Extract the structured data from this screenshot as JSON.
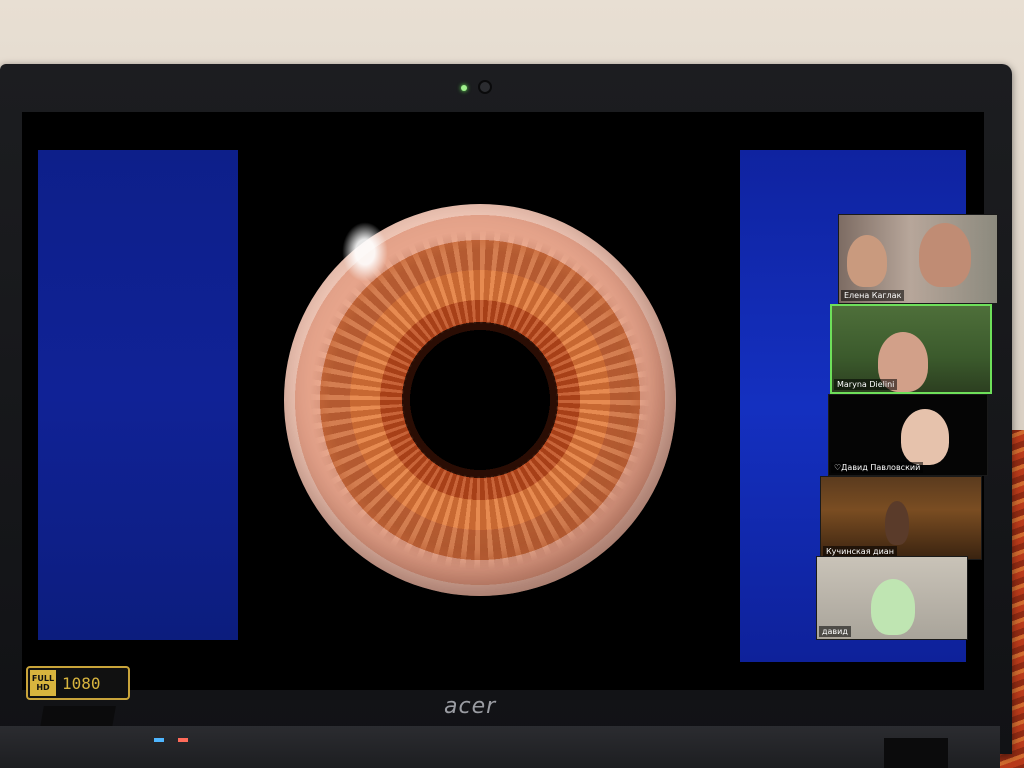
{
  "hardware": {
    "brand_logo": "acer",
    "hd_badge": {
      "mark_text": "FULL HD",
      "resolution": "1080"
    }
  },
  "video_call": {
    "participants": [
      {
        "name": "Елена Каглак",
        "active": false
      },
      {
        "name": "Maryna Dielini",
        "active": true
      },
      {
        "name": "♡Давид Павловский",
        "active": false
      },
      {
        "name": "Кучинская диан",
        "active": false
      },
      {
        "name": "давид",
        "active": false
      }
    ]
  },
  "colors": {
    "slide_blue": "#1430c0",
    "active_speaker_border": "#6ee05a"
  }
}
